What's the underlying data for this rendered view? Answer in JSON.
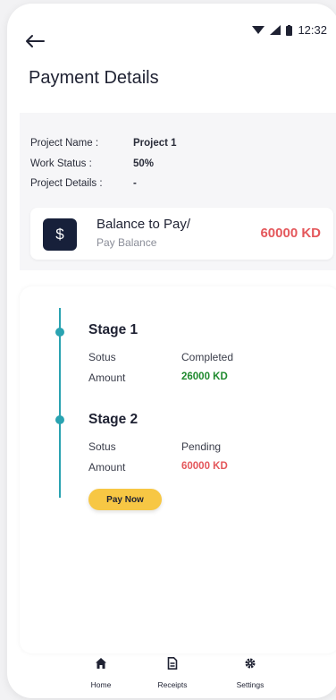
{
  "status_bar": {
    "time": "12:32"
  },
  "header": {
    "title": "Payment Details"
  },
  "details": {
    "rows": [
      {
        "label": "Project Name :",
        "value": "Project 1"
      },
      {
        "label": "Work Status :",
        "value": "50%"
      },
      {
        "label": "Project Details :",
        "value": "-"
      }
    ]
  },
  "balance": {
    "icon_symbol": "$",
    "title": "Balance to Pay/",
    "subtitle": "Pay Balance",
    "amount": "60000 KD",
    "amount_color": "#e4575b"
  },
  "stages": [
    {
      "title": "Stage 1",
      "status_label": "Sotus",
      "status_value": "Completed",
      "amount_label": "Amount",
      "amount_value": "26000 KD",
      "amount_color": "#1f8a2e"
    },
    {
      "title": "Stage 2",
      "status_label": "Sotus",
      "status_value": "Pending",
      "amount_label": "Amount",
      "amount_value": "60000 KD",
      "amount_color": "#e4575b"
    }
  ],
  "pay_now_label": "Pay Now",
  "bottom_nav": [
    {
      "label": "Home",
      "icon": "home-icon"
    },
    {
      "label": "Receipts",
      "icon": "receipt-icon"
    },
    {
      "label": "Settings",
      "icon": "gear-icon"
    }
  ],
  "colors": {
    "accent": "#2aa3b1",
    "button": "#f7c744",
    "dark": "#17203a"
  }
}
